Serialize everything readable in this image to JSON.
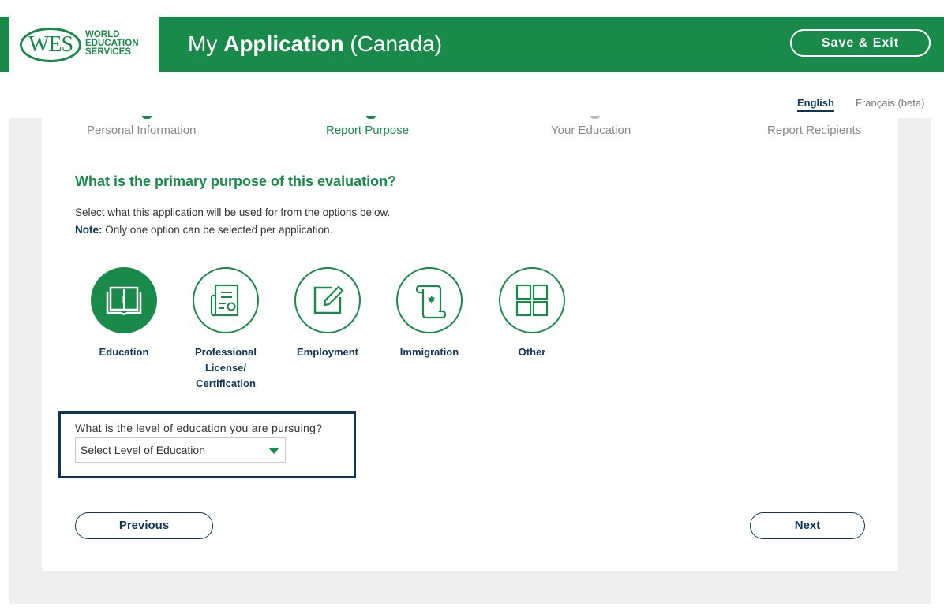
{
  "header": {
    "logo_mark": "WES",
    "logo_line1": "WORLD",
    "logo_line2": "EDUCATION",
    "logo_line3": "SERVICES",
    "title_prefix": "My",
    "title_bold": "Application",
    "title_suffix": "(Canada)",
    "save_exit_label": "Save & Exit",
    "brand_color": "#1a8a4a"
  },
  "language": {
    "english": "English",
    "french": "Français (beta)",
    "selected": "English"
  },
  "steps": [
    {
      "label": "Personal Information",
      "active": false
    },
    {
      "label": "Report Purpose",
      "active": true
    },
    {
      "label": "Your Education",
      "active": false
    },
    {
      "label": "Report Recipients",
      "active": false
    }
  ],
  "main": {
    "question": "What is the primary purpose of this evaluation?",
    "instruction": "Select what this application will be used for from the options below.",
    "note_prefix": "Note:",
    "note_text": " Only one option can be selected per application."
  },
  "purposes": [
    {
      "label": "Education",
      "icon": "book-icon",
      "selected": true
    },
    {
      "label": "Professional License/ Certification",
      "icon": "certificate-icon",
      "selected": false
    },
    {
      "label": "Employment",
      "icon": "edit-icon",
      "selected": false
    },
    {
      "label": "Immigration",
      "icon": "scroll-icon",
      "selected": false
    },
    {
      "label": "Other",
      "icon": "grid-icon",
      "selected": false
    }
  ],
  "education_level": {
    "label": "What is the level of education you are pursuing?",
    "selected_value": "Select Level of Education"
  },
  "nav": {
    "previous_label": "Previous",
    "next_label": "Next"
  }
}
